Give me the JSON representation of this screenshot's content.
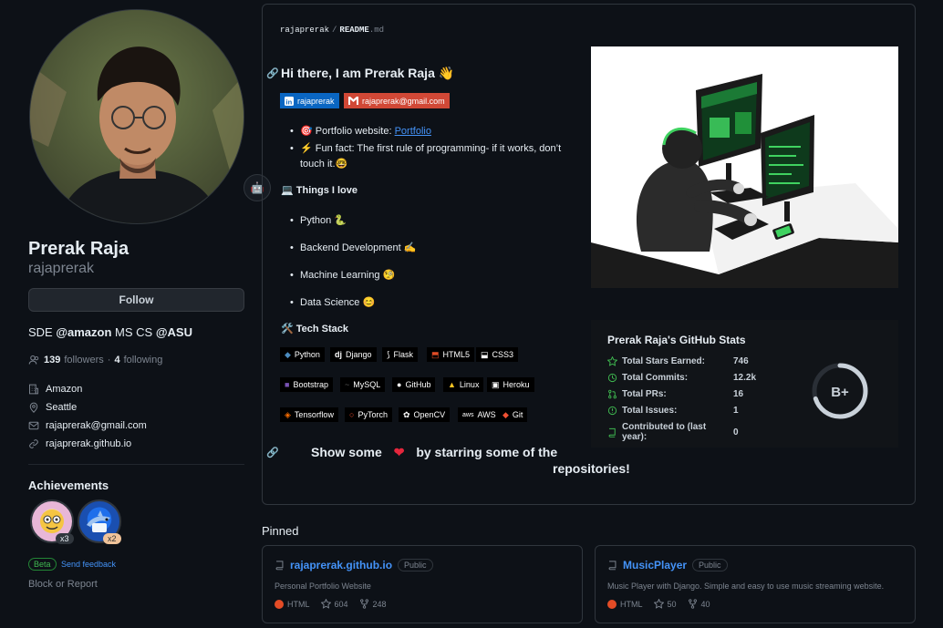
{
  "profile": {
    "name": "Prerak Raja",
    "login": "rajaprerak",
    "follow_label": "Follow",
    "bio_prefix": "SDE ",
    "bio_company": "@amazon",
    "bio_middle": " MS CS ",
    "bio_school": "@ASU",
    "followers_count": "139",
    "followers_label": "followers",
    "following_count": "4",
    "following_label": "following",
    "company": "Amazon",
    "location": "Seattle",
    "email": "rajaprerak@gmail.com",
    "website": "rajaprerak.github.io",
    "status_emoji": "🤖"
  },
  "achievements": {
    "title": "Achievements",
    "items": [
      {
        "name": "quickdraw",
        "count": "x3"
      },
      {
        "name": "shark",
        "count": "x2"
      }
    ],
    "beta_label": "Beta",
    "feedback_label": "Send feedback",
    "block_label": "Block or Report"
  },
  "readme": {
    "path_user": "rajaprerak",
    "path_sep": "/",
    "path_file": "README",
    "path_ext": ".md",
    "heading": "Hi there, I am Prerak Raja 👋",
    "shield_linkedin": "rajaprerak",
    "shield_gmail": "rajaprerak@gmail.com",
    "portfolio_prefix": "Portfolio website: ",
    "portfolio_link": "Portfolio",
    "funfact_line1": "Fun fact: The first rule of programming- if it works, don’t",
    "funfact_line2": "touch it.🤓",
    "things_heading": "Things I love",
    "loves": [
      "Python 🐍",
      "Backend Development ✍️",
      "Machine Learning 🧐",
      "Data Science 😊"
    ],
    "tech_heading": "Tech Stack",
    "tech_row1": [
      "Python",
      "Django",
      "Flask",
      "HTML5",
      "CSS3"
    ],
    "tech_row2": [
      "Bootstrap",
      "MySQL",
      "GitHub",
      "Linux",
      "Heroku"
    ],
    "tech_row3": [
      "Tensorflow",
      "PyTorch",
      "OpenCV",
      "AWS",
      "Git"
    ],
    "show_line1_a": "Show some",
    "show_line1_b": "by starring some of the",
    "show_line2": "repositories!"
  },
  "github_stats": {
    "title": "Prerak Raja's GitHub Stats",
    "rows": [
      {
        "label": "Total Stars Earned:",
        "value": "746"
      },
      {
        "label": "Total Commits:",
        "value": "12.2k"
      },
      {
        "label": "Total PRs:",
        "value": "16"
      },
      {
        "label": "Total Issues:",
        "value": "1"
      },
      {
        "label": "Contributed to (last year):",
        "value": "0"
      }
    ],
    "rank": "B+",
    "rank_progress_percent": 70
  },
  "pinned": {
    "title": "Pinned",
    "repos": [
      {
        "name": "rajaprerak.github.io",
        "visibility": "Public",
        "description": "Personal Portfolio Website",
        "language": "HTML",
        "stars": "604",
        "forks": "248"
      },
      {
        "name": "MusicPlayer",
        "visibility": "Public",
        "description": "Music Player with Django. Simple and easy to use music streaming website.",
        "language": "HTML",
        "stars": "50",
        "forks": "40"
      }
    ]
  },
  "colors": {
    "background": "#0d1117",
    "link": "#4493f8",
    "linkedin": "#0a66c2",
    "gmail": "#d14836",
    "html_lang": "#e34c26",
    "accent_green": "#3fb950"
  }
}
